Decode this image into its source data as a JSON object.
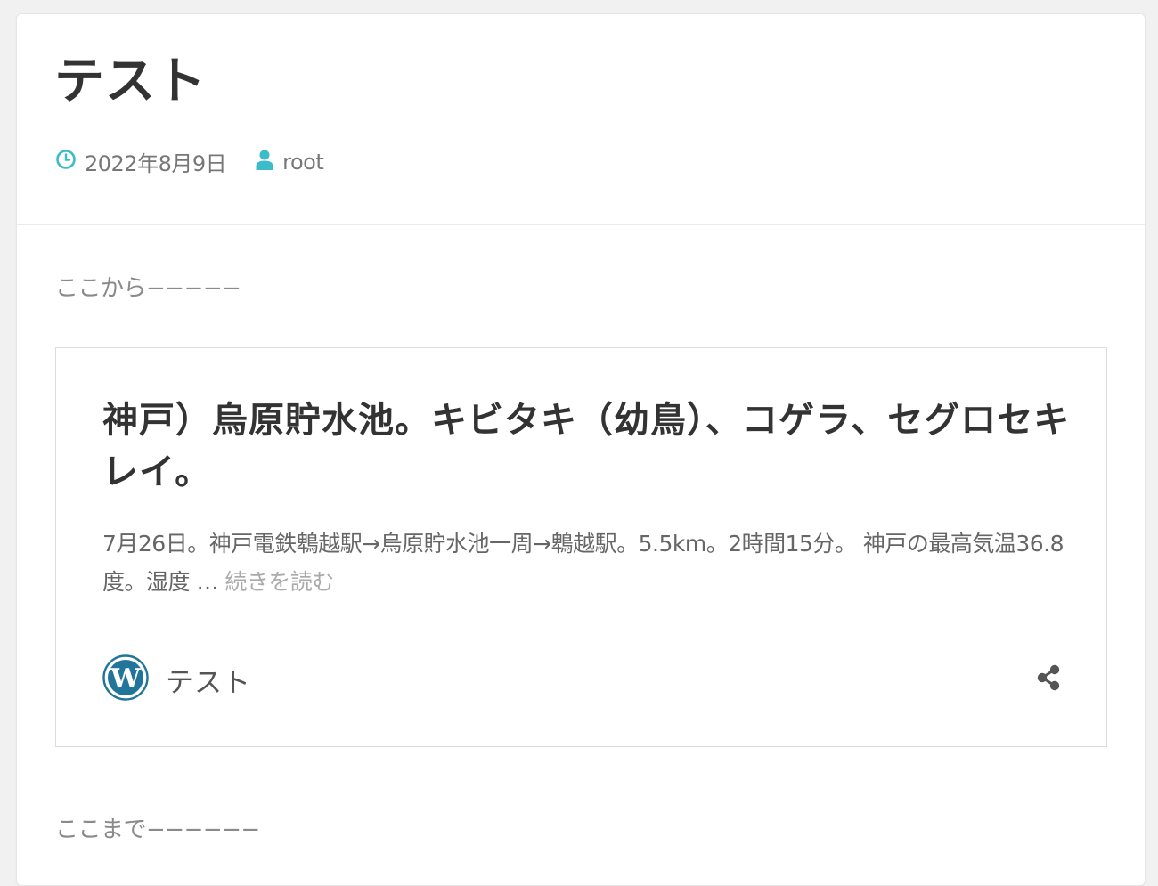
{
  "post": {
    "title": "テスト",
    "date": "2022年8月9日",
    "author": "root"
  },
  "content": {
    "para_top": "ここから−−−−−",
    "para_bottom": "ここまで−−−−−−"
  },
  "embed": {
    "title": "神戸）烏原貯水池。キビタキ（幼鳥）、コゲラ、セグロセキレイ。",
    "excerpt": "7月26日。神戸電鉄鵯越駅→烏原貯水池一周→鵯越駅。5.5km。2時間15分。 神戸の最高気温36.8度。湿度 …",
    "read_more": "続きを読む",
    "site_name": "テスト"
  },
  "icons": {
    "date": "clock-icon",
    "author": "user-icon",
    "site": "wordpress-icon",
    "share": "share-icon"
  },
  "colors": {
    "accent": "#3cbcc8",
    "wordpress_blue": "#21759b"
  }
}
